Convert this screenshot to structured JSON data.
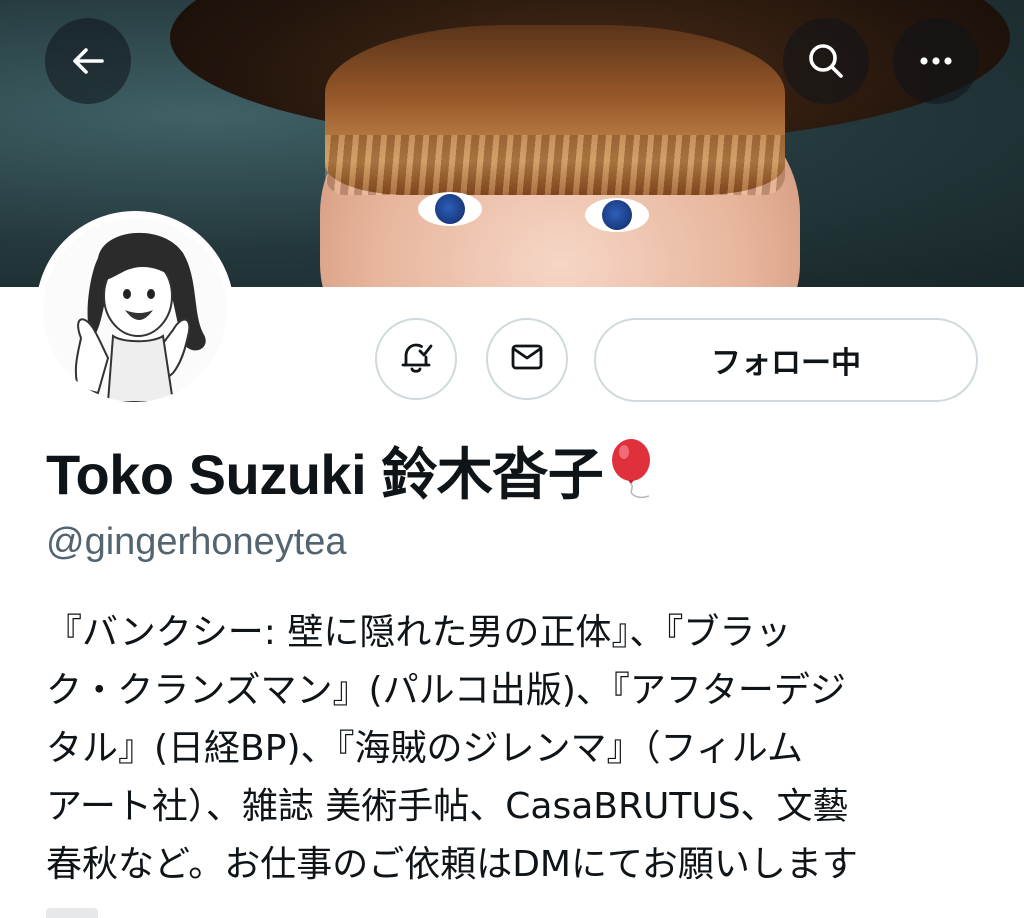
{
  "header": {
    "back_icon": "arrow-left-icon",
    "search_icon": "search-icon",
    "more_icon": "more-horizontal-icon"
  },
  "profile": {
    "display_name": "Toko Suzuki 鈴木沓子",
    "name_emoji": "balloon-icon",
    "handle": "@gingerhoneytea",
    "bio_lines": [
      "『バンクシー: 壁に隠れた男の正体』、『ブラッ",
      "ク・クランズマン』(パルコ出版)、『アフターデジ",
      "タル』(日経BP)、『海賊のジレンマ』（フィルム",
      "アート社）、雑誌 美術手帖、CasaBRUTUS、文藝",
      "春秋など。お仕事のご依頼はDMにてお願いします"
    ]
  },
  "actions": {
    "notify_icon": "bell-check-icon",
    "message_icon": "envelope-icon",
    "follow_label": "フォロー中"
  },
  "colors": {
    "text_primary": "#0f1419",
    "text_secondary": "#536471",
    "border": "#cfd9de"
  }
}
